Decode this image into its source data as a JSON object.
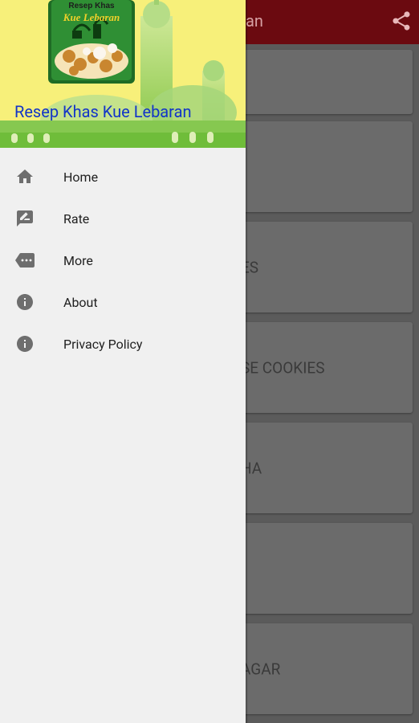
{
  "app_bar": {
    "title_visible": "an",
    "share_icon": "share-icon",
    "color": "#6b0a10"
  },
  "list": {
    "cards": [
      {
        "title": ""
      },
      {
        "title": ""
      },
      {
        "title": "ES"
      },
      {
        "title": "SE COOKIES"
      },
      {
        "title": "HA"
      },
      {
        "title": ""
      },
      {
        "title": "AGAR"
      }
    ]
  },
  "drawer": {
    "header": {
      "title": "Resep Khas Kue Lebaran",
      "logo_text_top": "Resep Khas",
      "logo_text_bottom": "Kue Lebaran"
    },
    "menu": [
      {
        "label": "Home",
        "icon": "home-icon"
      },
      {
        "label": "Rate",
        "icon": "rate-review-icon"
      },
      {
        "label": "More",
        "icon": "more-tag-icon"
      },
      {
        "label": "About",
        "icon": "info-icon"
      },
      {
        "label": "Privacy Policy",
        "icon": "info-icon"
      }
    ]
  },
  "colors": {
    "drawer_bg": "#f0f0f0",
    "header_bg": "#f7f07a",
    "title_blue": "#1234c8",
    "icon_gray": "#6e6e6e",
    "scrim": "#5b5b5b"
  }
}
